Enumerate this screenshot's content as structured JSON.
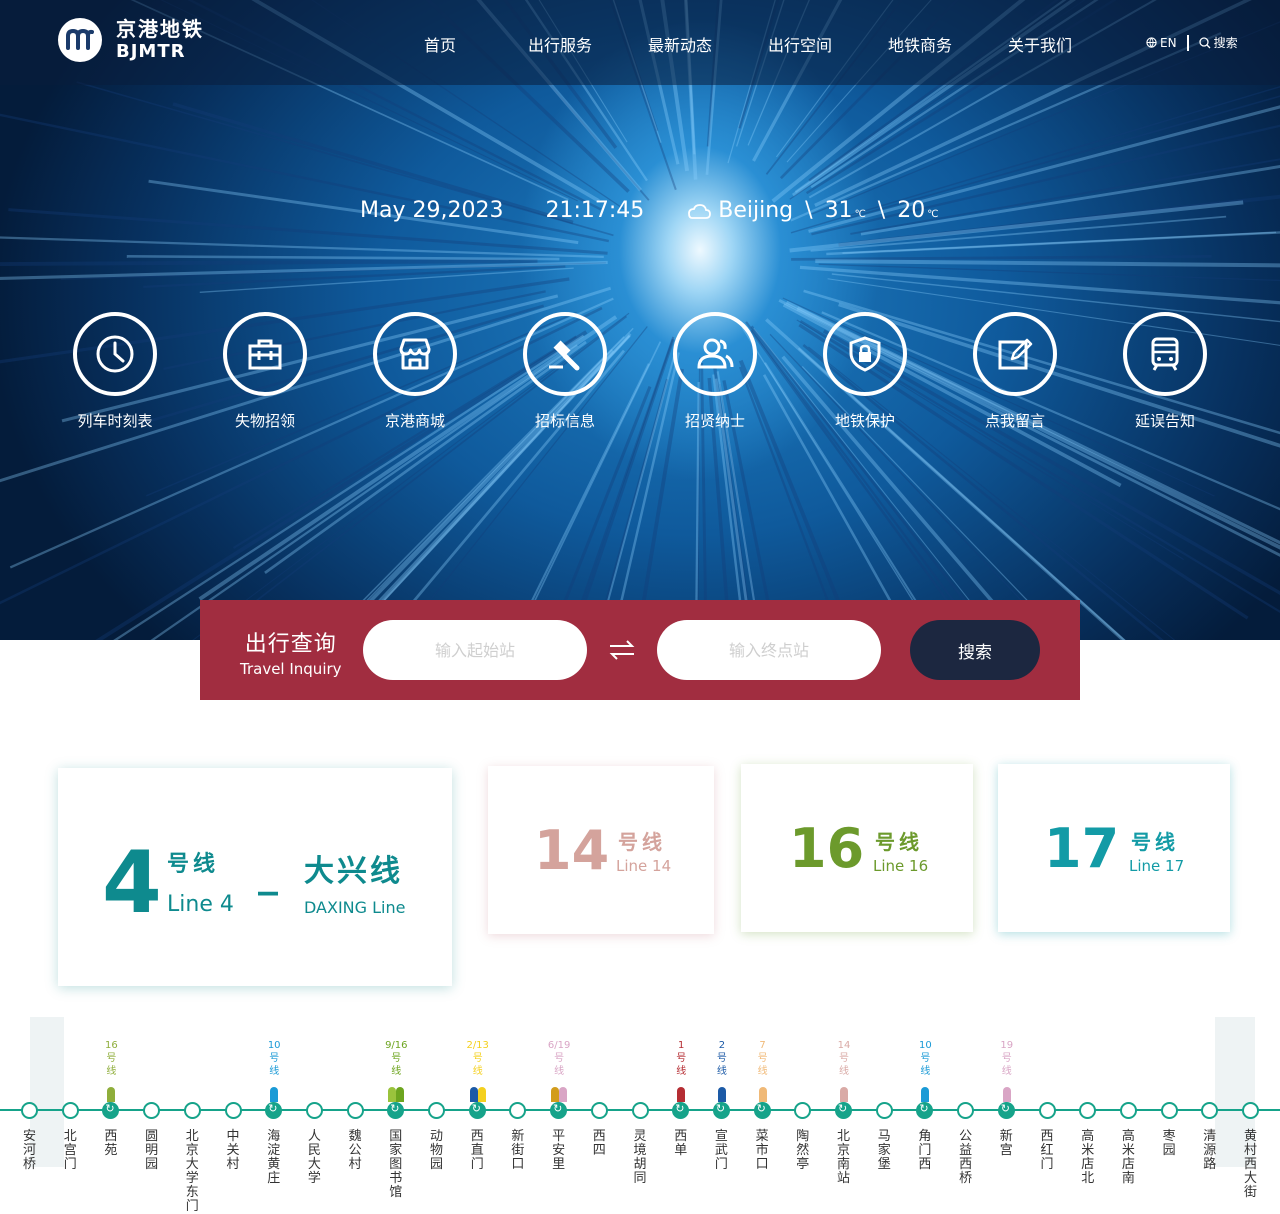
{
  "brand": {
    "name_cn": "京港地铁",
    "name_en": "BJMTR"
  },
  "nav": [
    "首页",
    "出行服务",
    "最新动态",
    "出行空间",
    "地铁商务",
    "关于我们"
  ],
  "tools": {
    "lang": "EN",
    "search": "搜索"
  },
  "info": {
    "date": "May 29,2023",
    "time": "21:17:45",
    "city": "Beijing",
    "high": "31",
    "low": "20",
    "unit": "℃",
    "sep": "\\"
  },
  "services": [
    {
      "label": "列车时刻表",
      "icon": "clock-icon"
    },
    {
      "label": "失物招领",
      "icon": "briefcase-icon"
    },
    {
      "label": "京港商城",
      "icon": "store-icon"
    },
    {
      "label": "招标信息",
      "icon": "gavel-icon"
    },
    {
      "label": "招贤纳士",
      "icon": "people-icon"
    },
    {
      "label": "地铁保护",
      "icon": "shield-lock-icon"
    },
    {
      "label": "点我留言",
      "icon": "edit-icon"
    },
    {
      "label": "延误告知",
      "icon": "train-icon"
    }
  ],
  "inquiry": {
    "title_cn": "出行查询",
    "title_en": "Travel Inquiry",
    "from_placeholder": "输入起始站",
    "to_placeholder": "输入终点站",
    "button": "搜索"
  },
  "lines": {
    "line4": {
      "num": "4",
      "hao": "号线",
      "en": "Line 4",
      "dash": "_",
      "daxing_cn": "大兴线",
      "daxing_en": "DAXING Line",
      "color": "#0e8a8e"
    },
    "line14": {
      "num": "14",
      "hao": "号线",
      "en": "Line 14",
      "color": "#d4a39c"
    },
    "line16": {
      "num": "16",
      "hao": "号线",
      "en": "Line 16",
      "color": "#6c9a2c"
    },
    "line17": {
      "num": "17",
      "hao": "号线",
      "en": "Line 17",
      "color": "#139ba6"
    }
  },
  "stations": [
    {
      "name": "安河桥"
    },
    {
      "name": "北宫门"
    },
    {
      "name": "西苑",
      "tag": "16号线",
      "colors": [
        "#8fae3b"
      ]
    },
    {
      "name": "圆明园"
    },
    {
      "name": "北京大学东门"
    },
    {
      "name": "中关村"
    },
    {
      "name": "海淀黄庄",
      "tag": "10号线",
      "colors": [
        "#1a9ad6"
      ]
    },
    {
      "name": "人民大学"
    },
    {
      "name": "魏公村"
    },
    {
      "name": "国家图书馆",
      "tag": "9/16号线",
      "colors": [
        "#9ac33c",
        "#6da51f"
      ]
    },
    {
      "name": "动物园"
    },
    {
      "name": "西直门",
      "tag": "2/13号线",
      "colors": [
        "#1c5aa6",
        "#f4d01e"
      ]
    },
    {
      "name": "新街口"
    },
    {
      "name": "平安里",
      "tag": "6/19号线",
      "colors": [
        "#d29c1c",
        "#d9a5c5"
      ]
    },
    {
      "name": "西四"
    },
    {
      "name": "灵境胡同"
    },
    {
      "name": "西单",
      "tag": "1号线",
      "colors": [
        "#b52d33"
      ]
    },
    {
      "name": "宣武门",
      "tag": "2号线",
      "colors": [
        "#1c5aa6"
      ]
    },
    {
      "name": "菜市口",
      "tag": "7号线",
      "colors": [
        "#f0b977"
      ]
    },
    {
      "name": "陶然亭"
    },
    {
      "name": "北京南站",
      "tag": "14号线",
      "colors": [
        "#d9aaa6"
      ]
    },
    {
      "name": "马家堡"
    },
    {
      "name": "角门西",
      "tag": "10号线",
      "colors": [
        "#1a9ad6"
      ]
    },
    {
      "name": "公益西桥"
    },
    {
      "name": "新宫",
      "tag": "19号线",
      "colors": [
        "#d9a5c5"
      ]
    },
    {
      "name": "西红门"
    },
    {
      "name": "高米店北"
    },
    {
      "name": "高米店南"
    },
    {
      "name": "枣园"
    },
    {
      "name": "清源路"
    },
    {
      "name": "黄村西大街"
    }
  ]
}
